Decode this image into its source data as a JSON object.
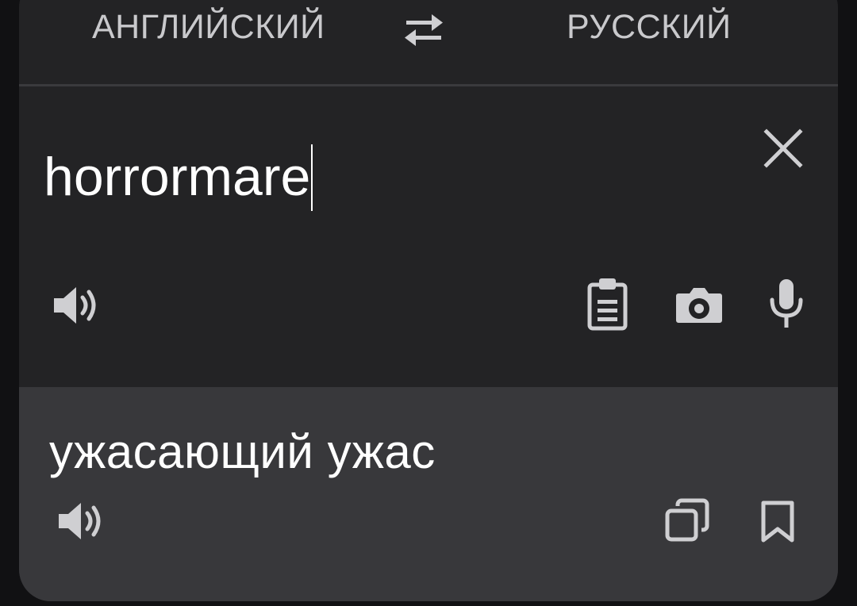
{
  "languages": {
    "source": "АНГЛИЙСКИЙ",
    "target": "РУССКИЙ"
  },
  "input": {
    "text": "horrormare"
  },
  "output": {
    "text": "ужасающий ужас"
  },
  "icons": {
    "swap": "swap-arrows-icon",
    "clear": "close-icon",
    "speak_source": "speaker-icon",
    "paste": "clipboard-icon",
    "camera": "camera-icon",
    "microphone": "microphone-icon",
    "speak_target": "speaker-icon",
    "copy": "copy-icon",
    "bookmark": "bookmark-icon"
  },
  "colors": {
    "card_background": "#232325",
    "output_background": "#38383b",
    "label_text": "#c9c9cc",
    "icon": "#cfcfd2"
  }
}
